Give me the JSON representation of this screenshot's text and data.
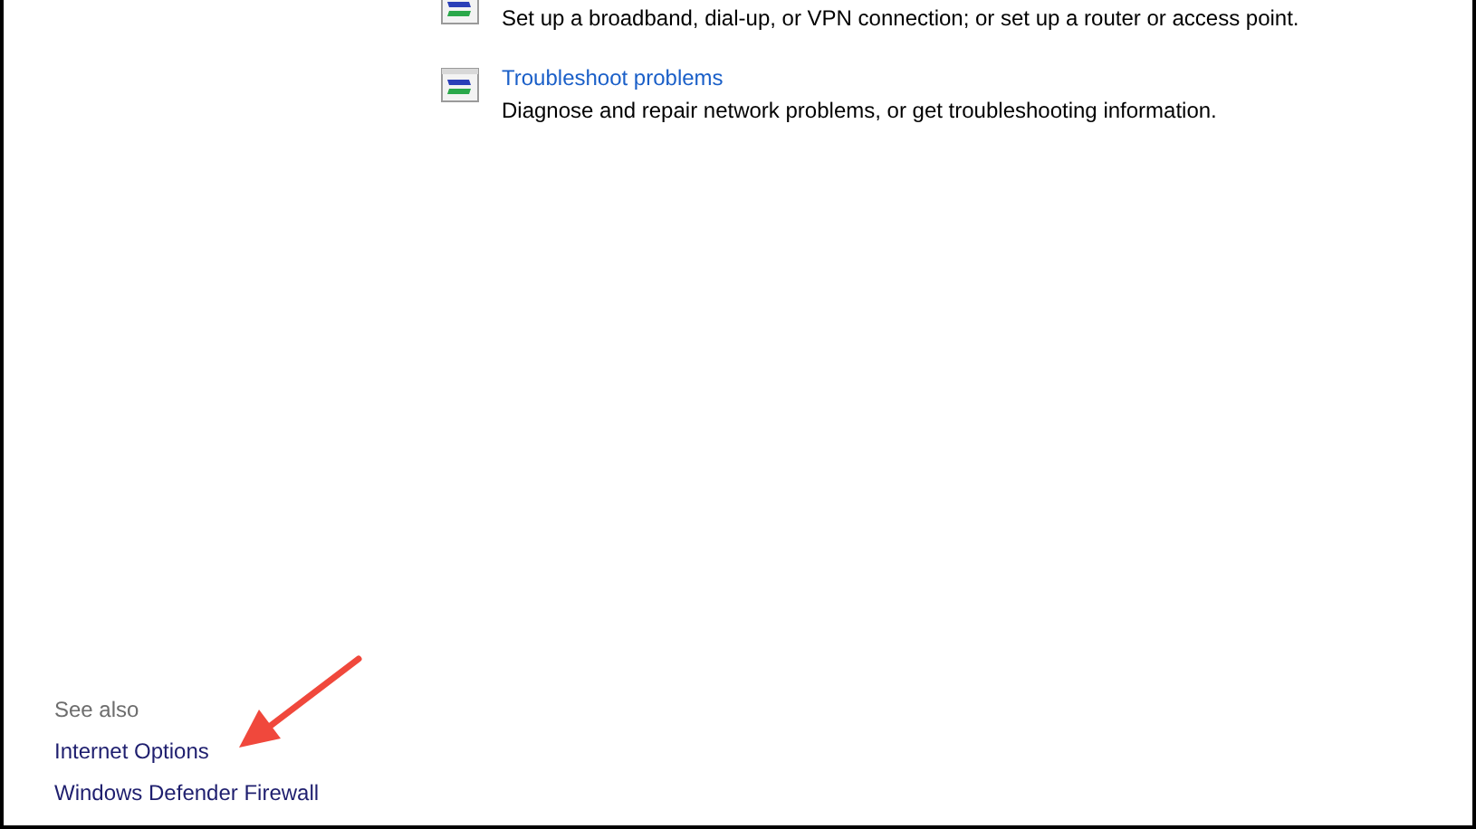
{
  "tasks": [
    {
      "description": "Set up a broadband, dial-up, or VPN connection; or set up a router or access point."
    },
    {
      "title": "Troubleshoot problems",
      "description": "Diagnose and repair network problems, or get troubleshooting information."
    }
  ],
  "see_also": {
    "heading": "See also",
    "links": [
      "Internet Options",
      "Windows Defender Firewall"
    ]
  }
}
